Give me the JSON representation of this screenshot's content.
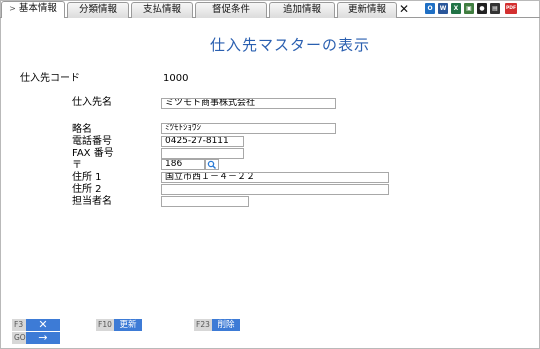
{
  "tabs": [
    {
      "label": "基本情報",
      "arrow": ">",
      "active": true
    },
    {
      "label": "分類情報"
    },
    {
      "label": "支払情報"
    },
    {
      "label": "督促条件"
    },
    {
      "label": "追加情報"
    },
    {
      "label": "更新情報"
    }
  ],
  "close_label": "✕",
  "toolbar": {
    "icons": [
      "outlook-icon",
      "word-icon",
      "excel-icon",
      "copy-icon",
      "camera-icon",
      "printer-icon",
      "pdf-icon"
    ],
    "icon_glyphs": [
      "O",
      "W",
      "X",
      "▣",
      "●",
      "▤",
      "PDF"
    ]
  },
  "title": "仕入先マスターの表示",
  "form": {
    "supplier_code": {
      "label": "仕入先コード",
      "value": "1000"
    },
    "supplier_name": {
      "label": "仕入先名",
      "value": "ミツモト商事株式会社"
    },
    "short_name": {
      "label": "略名",
      "value": "ﾐﾂﾓﾄｼｮｳｼﾞ"
    },
    "phone": {
      "label": "電話番号",
      "value": "0425-27-8111"
    },
    "fax": {
      "label": "FAX 番号",
      "value": ""
    },
    "postal": {
      "label": "〒",
      "value": "186"
    },
    "address1": {
      "label": "住所 1",
      "value": "国立市西１－４－２２"
    },
    "address2": {
      "label": "住所 2",
      "value": ""
    },
    "contact": {
      "label": "担当者名",
      "value": ""
    }
  },
  "footer": {
    "f3": {
      "key": "F3",
      "label": "✕"
    },
    "f10": {
      "key": "F10",
      "label": "更新"
    },
    "f23": {
      "key": "F23",
      "label": "削除"
    },
    "go": {
      "key": "GO",
      "label": "→"
    }
  },
  "colors": {
    "accent": "#3d7bd6",
    "title": "#2a5fb0"
  }
}
